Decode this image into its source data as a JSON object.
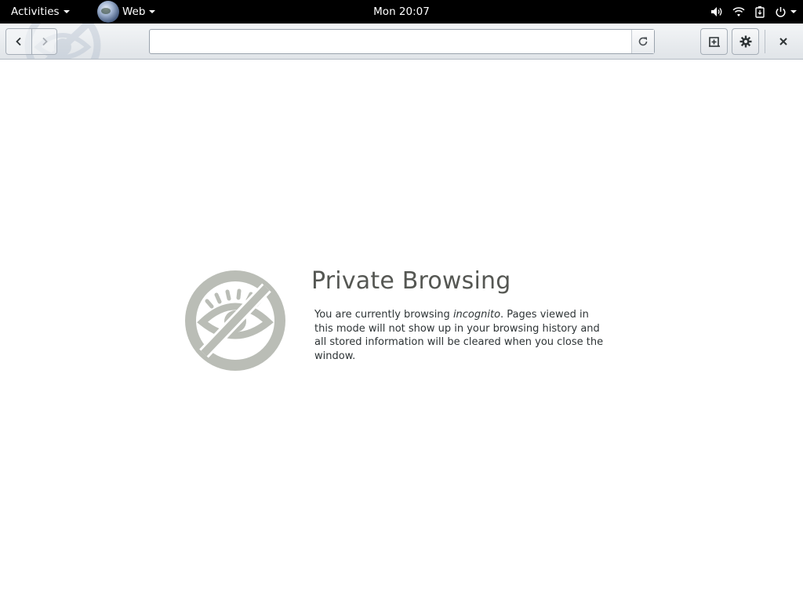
{
  "topbar": {
    "activities": "Activities",
    "app_menu": "Web",
    "clock": "Mon 20:07",
    "icons": [
      "volume-icon",
      "wifi-icon",
      "battery-icon",
      "power-icon"
    ]
  },
  "headerbar": {
    "url_value": "",
    "url_placeholder": "",
    "buttons": [
      "back-button",
      "forward-button",
      "reload-button",
      "new-tab-button",
      "settings-button",
      "close-button"
    ]
  },
  "page": {
    "title": "Private Browsing",
    "text_before": "You are currently browsing ",
    "text_em": "incognito",
    "text_after": ". Pages viewed in this mode will not show up in your browsing history and all stored information will be cleared when you close the window."
  },
  "colors": {
    "topbar_bg": "#000000",
    "icon_gray": "#babdb6",
    "title_color": "#555753"
  }
}
